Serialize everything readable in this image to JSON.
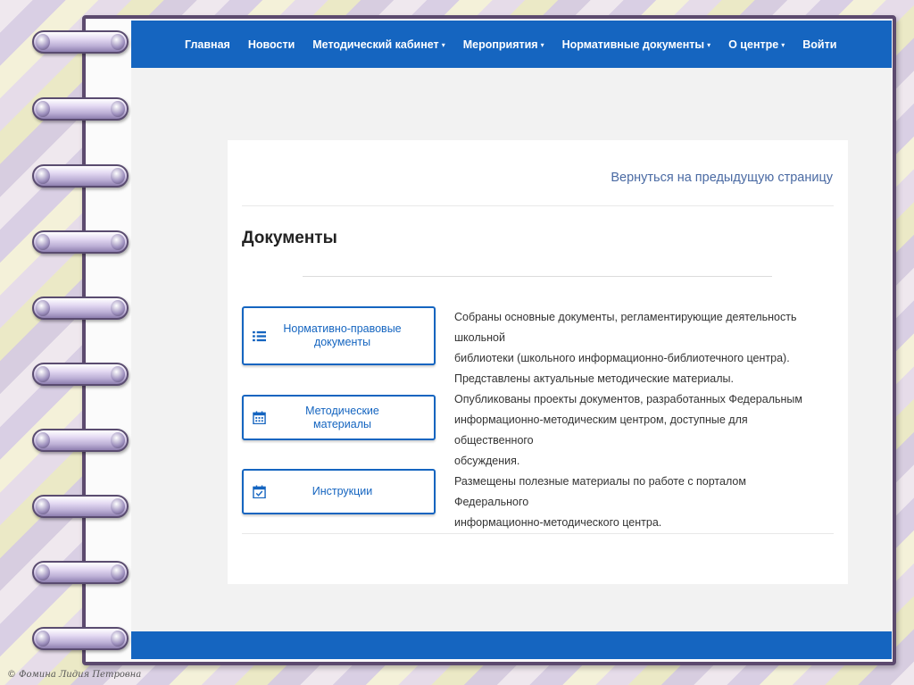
{
  "nav": {
    "items": [
      {
        "label": "Главная",
        "dropdown": false
      },
      {
        "label": "Новости",
        "dropdown": false
      },
      {
        "label": "Методический кабинет",
        "dropdown": true
      },
      {
        "label": "Мероприятия",
        "dropdown": true
      },
      {
        "label": "Нормативные документы",
        "dropdown": true
      },
      {
        "label": "О центре",
        "dropdown": true
      },
      {
        "label": "Войти",
        "dropdown": false
      }
    ],
    "caret": "▾"
  },
  "back_link": "Вернуться на предыдущую страницу",
  "heading": "Документы",
  "sections": [
    {
      "button": "Нормативно-правовые документы",
      "icon": "list-icon",
      "description": [
        "Собраны основные документы, регламентирующие деятельность школьной",
        "библиотеки (школьного информационно-библиотечного центра)."
      ]
    },
    {
      "button": "Методические материалы",
      "icon": "calendar-icon",
      "description": [
        "Представлены актуальные методические материалы.",
        "Опубликованы проекты документов, разработанных Федеральным",
        "информационно-методическим центром, доступные для общественного",
        "обсуждения."
      ]
    },
    {
      "button": "Инструкции",
      "icon": "calendar-check-icon",
      "description": [
        "Размещены полезные материалы по работе с порталом Федерального",
        "информационно-методического центра."
      ]
    }
  ],
  "watermark": "© Фомина Лидия Петровна",
  "colors": {
    "accent": "#1565c0",
    "frame": "#5c4a6e",
    "link": "#4a6aa3"
  }
}
